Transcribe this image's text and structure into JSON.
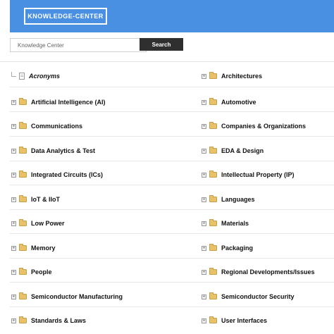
{
  "header": {
    "title_button": "KNOWLEDGE-CENTER"
  },
  "search": {
    "placeholder": "Knowledge Center",
    "button_label": "Search"
  },
  "left_items": [
    {
      "label": "Acronyms",
      "type": "doc"
    },
    {
      "label": "Artificial Intelligence (AI)",
      "type": "folder"
    },
    {
      "label": "Communications",
      "type": "folder"
    },
    {
      "label": "Data Analytics & Test",
      "type": "folder"
    },
    {
      "label": "Integrated Circuits (ICs)",
      "type": "folder"
    },
    {
      "label": "IoT & IIoT",
      "type": "folder"
    },
    {
      "label": "Low Power",
      "type": "folder"
    },
    {
      "label": "Memory",
      "type": "folder"
    },
    {
      "label": "People",
      "type": "folder"
    },
    {
      "label": "Semiconductor Manufacturing",
      "type": "folder"
    },
    {
      "label": "Standards & Laws",
      "type": "folder"
    }
  ],
  "right_items": [
    {
      "label": "Architectures",
      "type": "folder"
    },
    {
      "label": "Automotive",
      "type": "folder"
    },
    {
      "label": "Companies & Organizations",
      "type": "folder"
    },
    {
      "label": "EDA & Design",
      "type": "folder"
    },
    {
      "label": "Intellectual Property (IP)",
      "type": "folder"
    },
    {
      "label": "Languages",
      "type": "folder"
    },
    {
      "label": "Materials",
      "type": "folder"
    },
    {
      "label": "Packaging",
      "type": "folder"
    },
    {
      "label": "Regional Developments/Issues",
      "type": "folder"
    },
    {
      "label": "Semiconductor Security",
      "type": "folder"
    },
    {
      "label": "User Interfaces",
      "type": "folder"
    }
  ]
}
